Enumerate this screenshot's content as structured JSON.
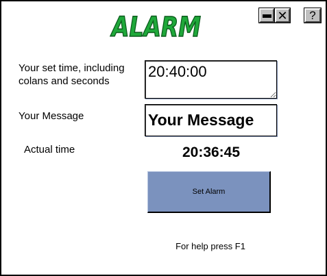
{
  "app": {
    "logo_text": "ALARM",
    "logo_color": "#1fa83a",
    "logo_outline_color": "#0b5a1c"
  },
  "title_bar": {
    "minimize_icon": "minimize-icon",
    "close_label": "✕",
    "help_label": "?"
  },
  "form": {
    "set_time_label": "Your set time, including colans and seconds",
    "set_time_value": "20:40:00",
    "message_label": "Your Message",
    "message_value": "Your Message",
    "actual_time_label": "Actual time",
    "actual_time_value": "20:36:45"
  },
  "actions": {
    "set_alarm_label": "Set Alarm",
    "set_alarm_color": "#7b92be"
  },
  "footer": {
    "help_text": "For help press F1"
  }
}
